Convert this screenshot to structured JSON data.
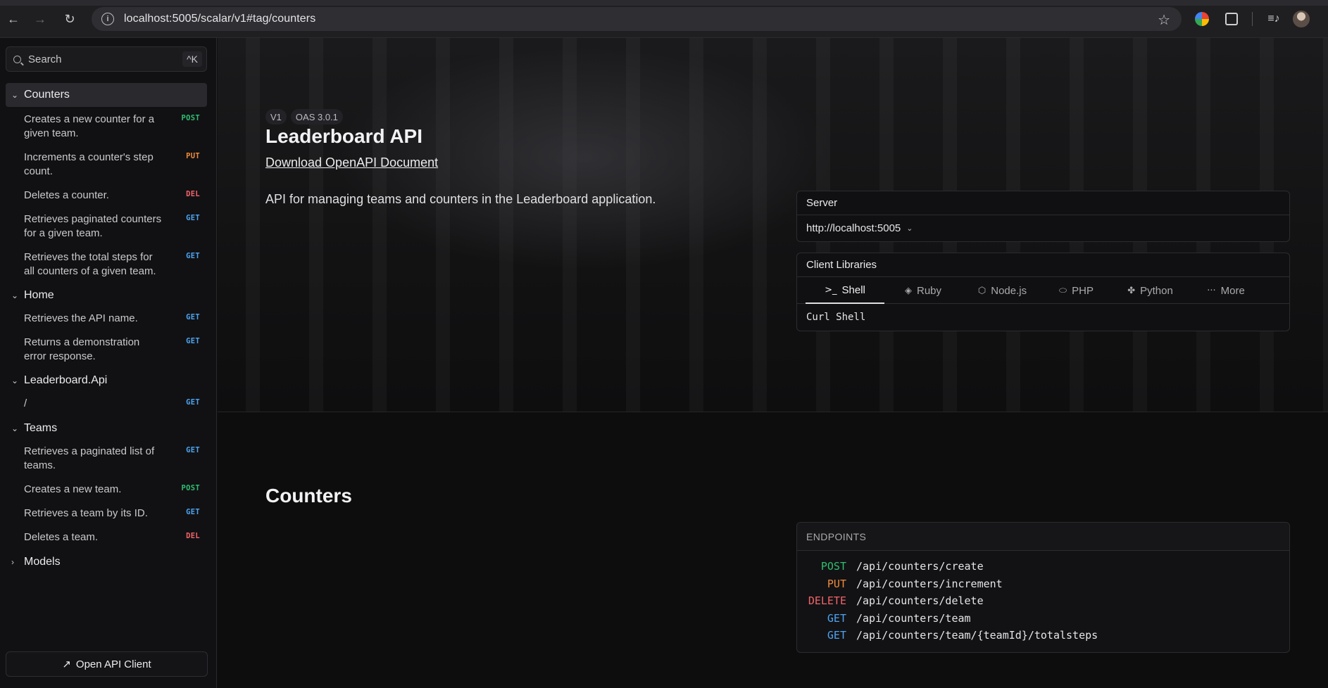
{
  "browser": {
    "url": "localhost:5005/scalar/v1#tag/counters"
  },
  "sidebar": {
    "search_placeholder": "Search",
    "search_shortcut": "^K",
    "groups": [
      {
        "title": "Counters",
        "items": [
          {
            "label": "Creates a new counter for a given team.",
            "method": "POST"
          },
          {
            "label": "Increments a counter's step count.",
            "method": "PUT"
          },
          {
            "label": "Deletes a counter.",
            "method": "DEL"
          },
          {
            "label": "Retrieves paginated counters for a given team.",
            "method": "GET"
          },
          {
            "label": "Retrieves the total steps for all counters of a given team.",
            "method": "GET"
          }
        ]
      },
      {
        "title": "Home",
        "items": [
          {
            "label": "Retrieves the API name.",
            "method": "GET"
          },
          {
            "label": "Returns a demonstration error response.",
            "method": "GET"
          }
        ]
      },
      {
        "title": "Leaderboard.Api",
        "items": [
          {
            "label": "/",
            "method": "GET"
          }
        ]
      },
      {
        "title": "Teams",
        "items": [
          {
            "label": "Retrieves a paginated list of teams.",
            "method": "GET"
          },
          {
            "label": "Creates a new team.",
            "method": "POST"
          },
          {
            "label": "Retrieves a team by its ID.",
            "method": "GET"
          },
          {
            "label": "Deletes a team.",
            "method": "DEL"
          }
        ]
      },
      {
        "title": "Models",
        "items": []
      }
    ],
    "open_client_label": "Open API Client"
  },
  "main": {
    "version_tag": "V1",
    "oas_tag": "OAS 3.0.1",
    "title": "Leaderboard API",
    "download_label": "Download OpenAPI Document",
    "description": "API for managing teams and counters in the Leaderboard application.",
    "server": {
      "header": "Server",
      "url": "http://localhost:5005"
    },
    "client_libraries": {
      "header": "Client Libraries",
      "tabs": [
        {
          "label": "Shell",
          "icon": "terminal-icon",
          "glyph": ">_"
        },
        {
          "label": "Ruby",
          "icon": "ruby-icon",
          "glyph": "◈"
        },
        {
          "label": "Node.js",
          "icon": "nodejs-icon",
          "glyph": "⬡"
        },
        {
          "label": "PHP",
          "icon": "php-icon",
          "glyph": "⬭"
        },
        {
          "label": "Python",
          "icon": "python-icon",
          "glyph": "✤"
        },
        {
          "label": "More",
          "icon": "more-icon",
          "glyph": "···"
        }
      ],
      "selected_client": "Curl Shell"
    },
    "section_title": "Counters",
    "endpoints": {
      "header": "ENDPOINTS",
      "rows": [
        {
          "method": "POST",
          "path": "/api/counters/create"
        },
        {
          "method": "PUT",
          "path": "/api/counters/increment"
        },
        {
          "method": "DELETE",
          "path": "/api/counters/delete"
        },
        {
          "method": "GET",
          "path": "/api/counters/team"
        },
        {
          "method": "GET",
          "path": "/api/counters/team/{teamId}/totalsteps"
        }
      ]
    }
  },
  "colors": {
    "post": "#2fbf71",
    "put": "#f08a3c",
    "delete": "#f1646a",
    "get": "#4ea3f0"
  }
}
